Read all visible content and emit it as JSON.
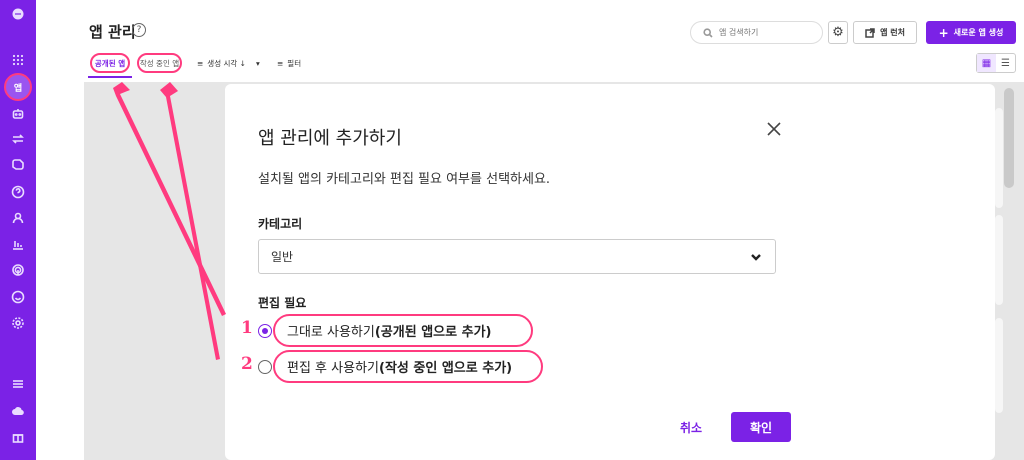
{
  "header": {
    "title": "앱 관리",
    "search_placeholder": "앱 검색하기",
    "launcher_label": "앱 런처",
    "new_app_label": "새로운 앱 생성"
  },
  "sidebar": {
    "active_label": "앱"
  },
  "tabs": {
    "published": "공개된 앱",
    "draft": "작성 중인 앱",
    "sort": "생성 시각 ↓",
    "filter": "필터"
  },
  "modal": {
    "title": "앱 관리에 추가하기",
    "description": "설치될 앱의 카테고리와 편집 필요 여부를 선택하세요.",
    "category_label": "카테고리",
    "category_value": "일반",
    "edit_label": "편집 필요",
    "options": [
      {
        "number": "1",
        "text": "그대로 사용하기 ",
        "bold": "(공개된 앱으로 추가)",
        "selected": true
      },
      {
        "number": "2",
        "text": "편집 후 사용하기 ",
        "bold": "(작성 중인 앱으로 추가)",
        "selected": false
      }
    ],
    "cancel": "취소",
    "confirm": "확인"
  },
  "colors": {
    "brand": "#7b22e6",
    "annotation": "#ff3b7f"
  }
}
